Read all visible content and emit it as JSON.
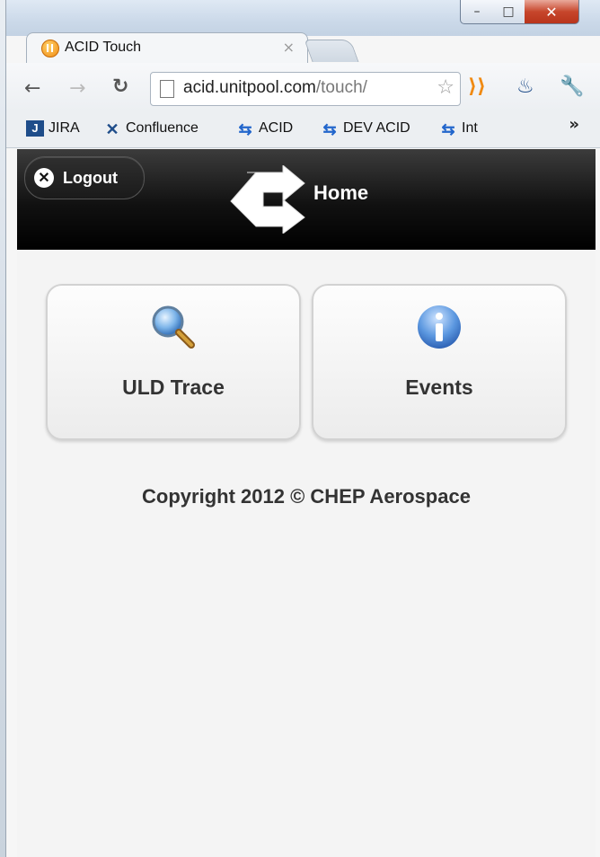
{
  "browser": {
    "tab_title": "ACID Touch",
    "tab_close": "×",
    "url_host": "acid.unitpool.com",
    "url_path": "/touch/",
    "bookmarks": [
      {
        "label": "JIRA",
        "icon": "jira-icon"
      },
      {
        "label": "Confluence",
        "icon": "confluence-icon"
      },
      {
        "label": "ACID",
        "icon": "acid-icon"
      },
      {
        "label": "DEV ACID",
        "icon": "acid-icon"
      },
      {
        "label": "Int",
        "icon": "acid-icon"
      }
    ],
    "more": "»"
  },
  "app": {
    "logout_label": "Logout",
    "title": "Home",
    "tiles": [
      {
        "label": "ULD Trace",
        "icon": "magnifier-icon"
      },
      {
        "label": "Events",
        "icon": "info-icon"
      }
    ],
    "copyright": "Copyright 2012 © CHEP Aerospace"
  },
  "colors": {
    "header_bg": "#111111",
    "content_bg": "#f4f4f4",
    "acid_blue": "#2266cc"
  }
}
